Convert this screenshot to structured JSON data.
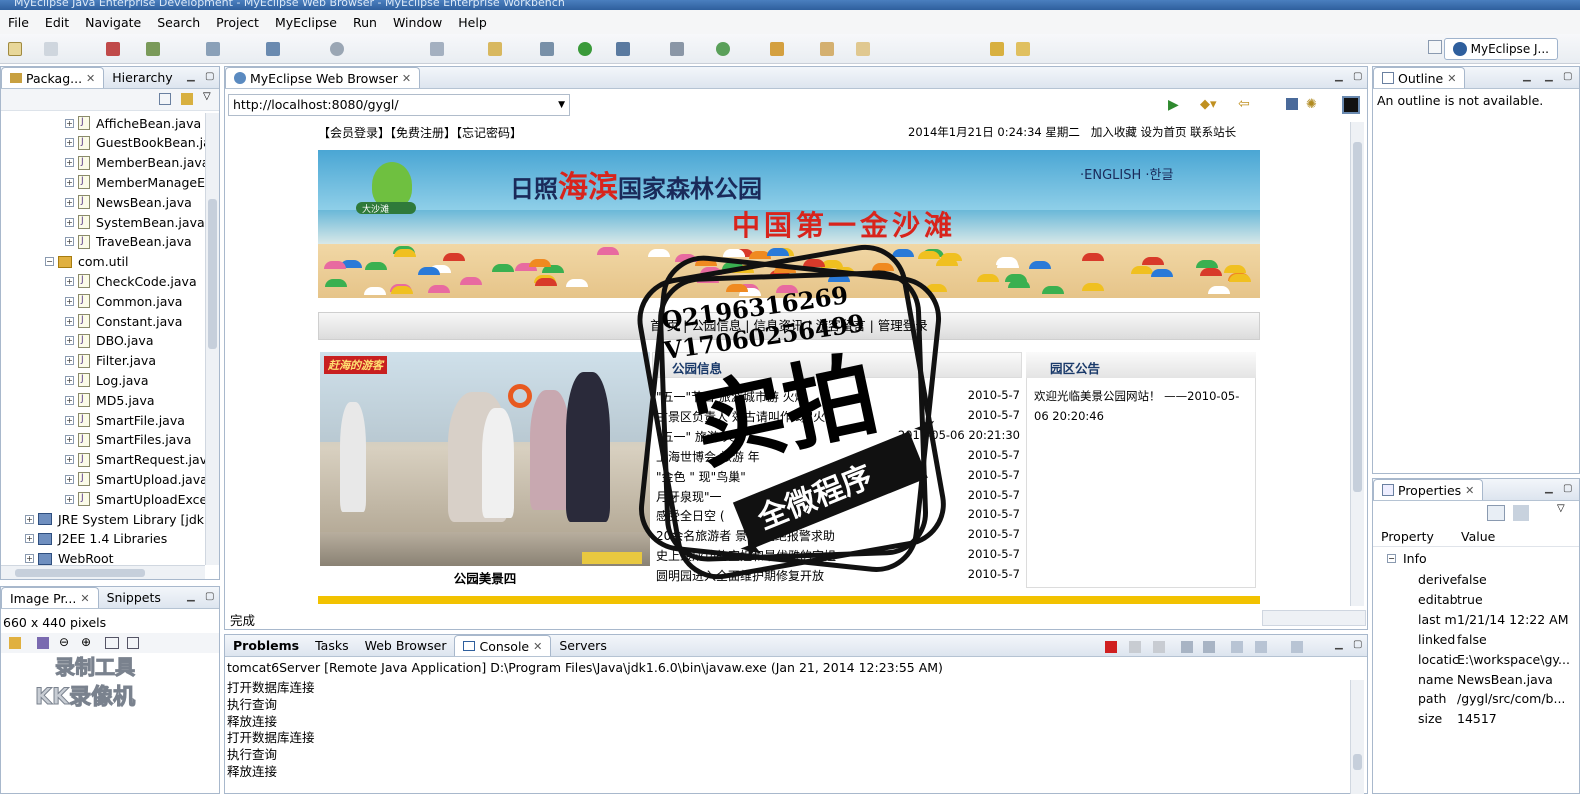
{
  "window": {
    "title": "MyEclipse Java Enterprise Development - MyEclipse Web Browser - MyEclipse Enterprise Workbench"
  },
  "menu": [
    "File",
    "Edit",
    "Navigate",
    "Search",
    "Project",
    "MyEclipse",
    "Run",
    "Window",
    "Help"
  ],
  "perspective": {
    "label": "MyEclipse J..."
  },
  "package_explorer": {
    "tabs": [
      "Packag...",
      "Hierarchy"
    ],
    "items": [
      {
        "label": "AfficheBean.java",
        "type": "file",
        "indent": 2
      },
      {
        "label": "GuestBookBean.ja",
        "type": "file",
        "indent": 2
      },
      {
        "label": "MemberBean.java",
        "type": "file",
        "indent": 2
      },
      {
        "label": "MemberManageE",
        "type": "file",
        "indent": 2
      },
      {
        "label": "NewsBean.java",
        "type": "file",
        "indent": 2
      },
      {
        "label": "SystemBean.java",
        "type": "file",
        "indent": 2
      },
      {
        "label": "TraveBean.java",
        "type": "file",
        "indent": 2
      },
      {
        "label": "com.util",
        "type": "package",
        "indent": 1
      },
      {
        "label": "CheckCode.java",
        "type": "file",
        "indent": 2
      },
      {
        "label": "Common.java",
        "type": "file",
        "indent": 2
      },
      {
        "label": "Constant.java",
        "type": "file",
        "indent": 2
      },
      {
        "label": "DBO.java",
        "type": "file",
        "indent": 2
      },
      {
        "label": "Filter.java",
        "type": "file",
        "indent": 2
      },
      {
        "label": "Log.java",
        "type": "file",
        "indent": 2
      },
      {
        "label": "MD5.java",
        "type": "file",
        "indent": 2
      },
      {
        "label": "SmartFile.java",
        "type": "file",
        "indent": 2
      },
      {
        "label": "SmartFiles.java",
        "type": "file",
        "indent": 2
      },
      {
        "label": "SmartRequest.jav",
        "type": "file",
        "indent": 2
      },
      {
        "label": "SmartUpload.java",
        "type": "file",
        "indent": 2
      },
      {
        "label": "SmartUploadExce",
        "type": "file",
        "indent": 2
      },
      {
        "label": "JRE System Library [jdk1",
        "type": "lib",
        "indent": 0
      },
      {
        "label": "J2EE 1.4 Libraries",
        "type": "lib",
        "indent": 0
      },
      {
        "label": "WebRoot",
        "type": "lib",
        "indent": 0
      }
    ]
  },
  "image_preview": {
    "tabs": [
      "Image Pr...",
      "Snippets"
    ],
    "size": "660 x 440 pixels"
  },
  "watermark": {
    "line1": "录制工具",
    "line2": "KK录像机"
  },
  "browser": {
    "tab": "MyEclipse Web Browser",
    "url": "http://localhost:8080/gygl/",
    "status": "完成"
  },
  "site": {
    "top_links": "【会员登录】【免费注册】【忘记密码】",
    "datetime": "2014年1月21日 0:24:34 星期二",
    "top_right_links": "加入收藏 设为首页 联系站长",
    "banner_title_a": "日照",
    "banner_title_b": "海滨",
    "banner_title_c": "国家森林公园",
    "banner_slogan": "中国第一金沙滩",
    "banner_lang": "·ENGLISH ·한글",
    "banner_logo_label": "大沙滩",
    "nav": "首 页 | 公园信息 | 信息资讯 | 游客留言 | 管理登录",
    "photo_label": "赶海的游客",
    "photo_caption": "公园美景四",
    "news_title": "公园信息",
    "news": [
      {
        "text": "\"五一\"节日 旅游城市游 火爆",
        "date": "2010-5-7"
      },
      {
        "text": "古景区负责人 效古请叫作 球\"火\"",
        "date": "2010-5-7"
      },
      {
        "text": "\"五一\" 旅游 火",
        "date": "2010-05-06 20:21:30"
      },
      {
        "text": "上海世博会 旅游 年",
        "date": "2010-5-7"
      },
      {
        "text": "\"金色 \" 现\"鸟巢\"",
        "date": "2010-5-7"
      },
      {
        "text": "月牙泉现\"一",
        "date": "2010-5-7"
      },
      {
        "text": "感受全日空 (",
        "date": "2010-5-7"
      },
      {
        "text": "20余名旅游者 景区 拒绝报警求助",
        "date": "2010-5-7"
      },
      {
        "text": "史上最成功的空姐和最优雅的空姐",
        "date": "2010-5-7"
      },
      {
        "text": "圆明园进入全面维护期修复开放",
        "date": "2010-5-7"
      }
    ],
    "notice_title": "园区公告",
    "notice_text": "欢迎光临美景公园网站！ ——2010-05-06 20:20:46"
  },
  "stamp": {
    "qq": "Q2196316269",
    "v": "V17060256499",
    "big": "实拍",
    "small": "全微程序"
  },
  "outline": {
    "tab": "Outline",
    "message": "An outline is not available."
  },
  "properties": {
    "tab": "Properties",
    "headers": [
      "Property",
      "Value"
    ],
    "group": "Info",
    "rows": [
      {
        "key": "derive",
        "value": "false"
      },
      {
        "key": "editab",
        "value": "true"
      },
      {
        "key": "last m",
        "value": "1/21/14 12:22 AM"
      },
      {
        "key": "linked",
        "value": "false"
      },
      {
        "key": "locatic",
        "value": "E:\\workspace\\gy..."
      },
      {
        "key": "name",
        "value": "NewsBean.java"
      },
      {
        "key": "path",
        "value": "/gygl/src/com/b..."
      },
      {
        "key": "size",
        "value": "14517"
      }
    ]
  },
  "console": {
    "tabs": [
      "Problems",
      "Tasks",
      "Web Browser",
      "Console",
      "Servers"
    ],
    "header": "tomcat6Server [Remote Java Application] D:\\Program Files\\Java\\jdk1.6.0\\bin\\javaw.exe (Jan 21, 2014 12:23:55 AM)",
    "lines": [
      "打开数据库连接",
      "执行查询",
      "释放连接",
      "打开数据库连接",
      "执行查询",
      "释放连接"
    ]
  }
}
